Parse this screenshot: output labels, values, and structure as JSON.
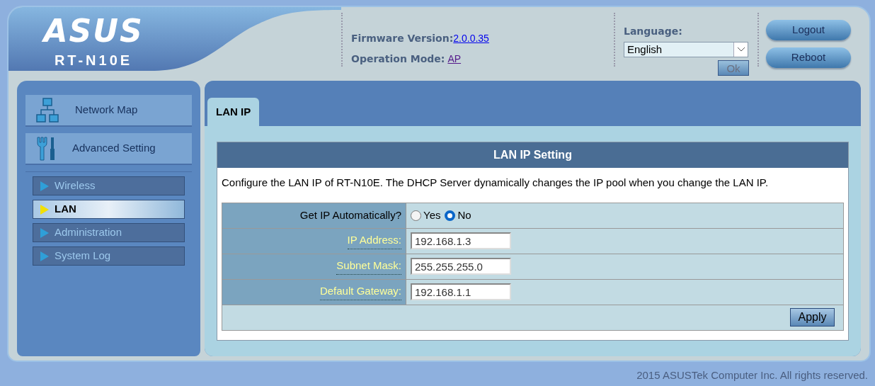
{
  "header": {
    "logo": "ASUS",
    "model": "RT-N10E",
    "firmware_label": "Firmware Version:",
    "firmware_value": "2.0.0.35",
    "mode_label": "Operation Mode:",
    "mode_value": "AP",
    "language_label": "Language:",
    "language_value": "English",
    "ok_button": "Ok",
    "buttons": [
      "Logout",
      "Reboot"
    ]
  },
  "sidebar": {
    "menus": [
      {
        "label": "Network Map",
        "kind": "network"
      },
      {
        "label": "Advanced Setting",
        "kind": "tools"
      }
    ],
    "items": [
      {
        "label": "Wireless",
        "selected": false
      },
      {
        "label": "LAN",
        "selected": true
      },
      {
        "label": "Administration",
        "selected": false
      },
      {
        "label": "System Log",
        "selected": false
      }
    ]
  },
  "tabs": [
    {
      "label": "LAN IP",
      "selected": true
    }
  ],
  "panel": {
    "title": "LAN IP Setting",
    "description": "Configure the LAN IP of RT-N10E. The DHCP Server dynamically changes the IP pool when you change the LAN IP.",
    "rows": [
      {
        "kind": "radio",
        "label": "Get IP Automatically?",
        "options": [
          {
            "label": "Yes",
            "selected": false
          },
          {
            "label": "No",
            "selected": true
          }
        ]
      },
      {
        "kind": "text",
        "label": "IP Address:",
        "value": "192.168.1.3"
      },
      {
        "kind": "text",
        "label": "Subnet Mask:",
        "value": "255.255.255.0"
      },
      {
        "kind": "text",
        "label": "Default Gateway:",
        "value": "192.168.1.1"
      }
    ],
    "apply_button": "Apply"
  },
  "footer": "2015 ASUSTek Computer Inc. All rights reserved."
}
